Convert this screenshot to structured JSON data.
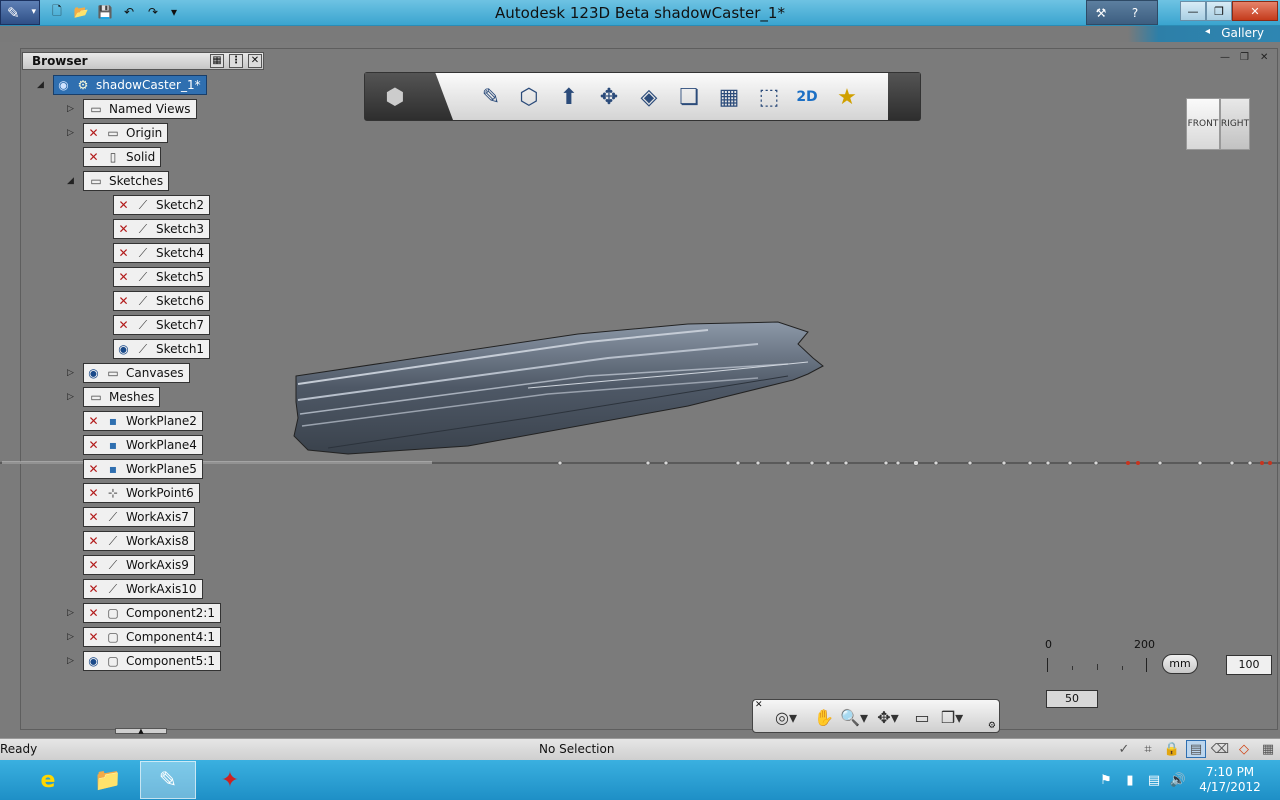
{
  "window": {
    "title": "Autodesk 123D Beta    shadowCaster_1*",
    "gallery_label": "Gallery"
  },
  "browser": {
    "title": "Browser",
    "nodes": [
      {
        "label": "shadowCaster_1*",
        "visibility": "eye",
        "icon": "assembly-icon",
        "expanded": true,
        "selected": true
      },
      {
        "label": "Named Views",
        "visibility": "none",
        "icon": "folder-icon",
        "expandable": true
      },
      {
        "label": "Origin",
        "visibility": "hidden",
        "icon": "folder-icon",
        "expandable": true
      },
      {
        "label": "Solid",
        "visibility": "hidden",
        "icon": "solid-icon"
      },
      {
        "label": "Sketches",
        "visibility": "none",
        "icon": "folder-icon",
        "expanded": true
      },
      {
        "label": "Sketch2",
        "visibility": "hidden",
        "icon": "sketch-icon"
      },
      {
        "label": "Sketch3",
        "visibility": "hidden",
        "icon": "sketch-icon"
      },
      {
        "label": "Sketch4",
        "visibility": "hidden",
        "icon": "sketch-icon"
      },
      {
        "label": "Sketch5",
        "visibility": "hidden",
        "icon": "sketch-icon"
      },
      {
        "label": "Sketch6",
        "visibility": "hidden",
        "icon": "sketch-icon"
      },
      {
        "label": "Sketch7",
        "visibility": "hidden",
        "icon": "sketch-icon"
      },
      {
        "label": "Sketch1",
        "visibility": "eye",
        "icon": "sketch-icon"
      },
      {
        "label": "Canvases",
        "visibility": "eye",
        "icon": "folder-icon",
        "expandable": true
      },
      {
        "label": "Meshes",
        "visibility": "none",
        "icon": "folder-icon",
        "expandable": true
      },
      {
        "label": "WorkPlane2",
        "visibility": "hidden",
        "icon": "workplane-icon"
      },
      {
        "label": "WorkPlane4",
        "visibility": "hidden",
        "icon": "workplane-icon"
      },
      {
        "label": "WorkPlane5",
        "visibility": "hidden",
        "icon": "workplane-icon"
      },
      {
        "label": "WorkPoint6",
        "visibility": "hidden",
        "icon": "workpoint-icon"
      },
      {
        "label": "WorkAxis7",
        "visibility": "hidden",
        "icon": "workaxis-icon"
      },
      {
        "label": "WorkAxis8",
        "visibility": "hidden",
        "icon": "workaxis-icon"
      },
      {
        "label": "WorkAxis9",
        "visibility": "hidden",
        "icon": "workaxis-icon"
      },
      {
        "label": "WorkAxis10",
        "visibility": "hidden",
        "icon": "workaxis-icon"
      },
      {
        "label": "Component2:1",
        "visibility": "hidden",
        "icon": "component-icon",
        "expandable": true
      },
      {
        "label": "Component4:1",
        "visibility": "hidden",
        "icon": "component-icon",
        "expandable": true
      },
      {
        "label": "Component5:1",
        "visibility": "eye",
        "icon": "component-icon",
        "expandable": true
      }
    ]
  },
  "viewcube": {
    "front": "FRONT",
    "right": "RIGHT"
  },
  "scale": {
    "tick_start": "0",
    "tick_end": "200",
    "unit": "mm",
    "value_right": "100",
    "value_bottom": "50"
  },
  "status": {
    "left": "Ready",
    "middle": "No Selection"
  },
  "clock": {
    "time": "7:10 PM",
    "date": "4/17/2012"
  },
  "colors": {
    "accent": "#3aa4cf",
    "selection": "#2f6fb0",
    "hidden_marker": "#b21a1a",
    "taskbar": "#1e8fc6"
  }
}
